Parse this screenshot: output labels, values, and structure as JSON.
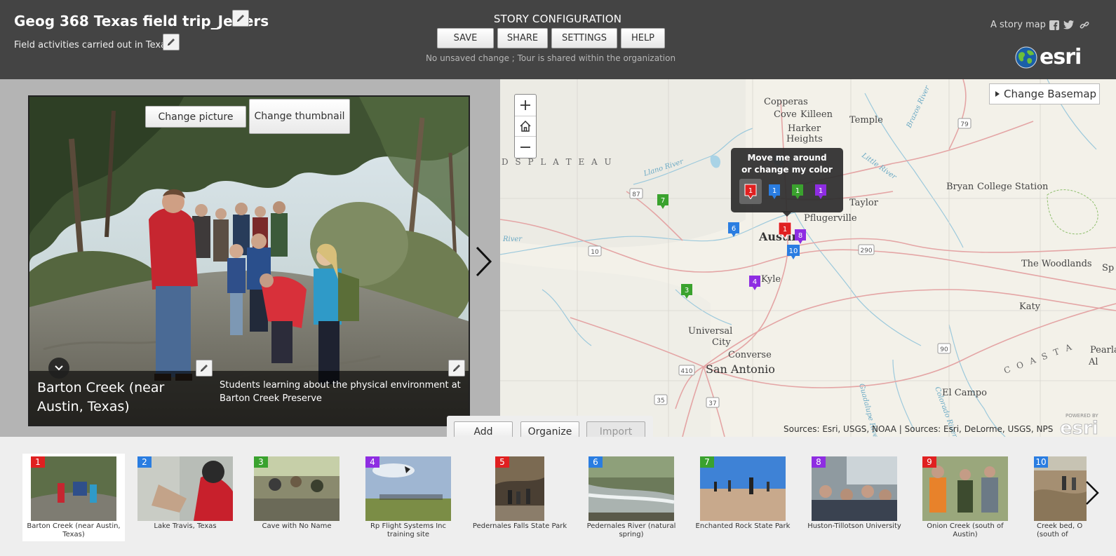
{
  "header": {
    "title": "Geog 368 Texas field trip_Jeffers",
    "subtitle": "Field activities carried out in Texas",
    "config_title": "STORY CONFIGURATION",
    "buttons": {
      "save": "SAVE",
      "share": "SHARE",
      "settings": "SETTINGS",
      "help": "HELP"
    },
    "status": "No unsaved change ; Tour is shared within the organization",
    "storymap_link": "A story map",
    "logo_text": "esri",
    "icons": [
      "facebook-icon",
      "twitter-icon",
      "link-icon",
      "pencil-icon"
    ]
  },
  "media": {
    "change_picture": "Change picture",
    "change_thumbnail": "Change thumbnail",
    "place_name": "Barton Creek (near Austin, Texas)",
    "description": "Students learning about the physical environment at Barton Creek Preserve"
  },
  "map": {
    "change_basemap": "Change Basemap",
    "popup_text_1": "Move me around",
    "popup_text_2": "or change my color",
    "popup_colors": [
      {
        "label": "1",
        "color": "#e02020"
      },
      {
        "label": "1",
        "color": "#2a7de1"
      },
      {
        "label": "1",
        "color": "#3aa22e"
      },
      {
        "label": "1",
        "color": "#8e2de2"
      }
    ],
    "sources": "Sources: Esri, USGS, NOAA | Sources: Esri, DeLorme, USGS, NPS",
    "powered_by": "POWERED BY",
    "cities": [
      "Copperas",
      "Cove",
      "Killeen",
      "Temple",
      "Harker",
      "Heights",
      "Taylor",
      "Pflugerville",
      "Austin",
      "Bryan",
      "College Station",
      "Kyle",
      "The Woodlands",
      "Katy",
      "Universal",
      "City",
      "Converse",
      "San Antonio",
      "El Campo",
      "Pearlan",
      "Al",
      "Sp"
    ],
    "region_labels": [
      "D S   P L A T E A U",
      "C O A S T A"
    ],
    "rivers": [
      "Llano River",
      "Brazos River",
      "Little River",
      "Guadalupe River",
      "Colorado River",
      "River"
    ],
    "highways": [
      "79",
      "87",
      "10",
      "290",
      "90",
      "410",
      "35",
      "37"
    ],
    "markers": [
      {
        "label": "7",
        "color": "#3aa22e"
      },
      {
        "label": "6",
        "color": "#2a7de1"
      },
      {
        "label": "1",
        "color": "#e02020"
      },
      {
        "label": "8",
        "color": "#8e2de2"
      },
      {
        "label": "10",
        "color": "#2a7de1"
      },
      {
        "label": "4",
        "color": "#8e2de2"
      },
      {
        "label": "3",
        "color": "#3aa22e"
      }
    ]
  },
  "builder": {
    "add": "Add",
    "organize": "Organize",
    "import": "Import"
  },
  "carousel": [
    {
      "num": "1",
      "color": "#e02020",
      "label": "Barton Creek (near Austin, Texas)"
    },
    {
      "num": "2",
      "color": "#2a7de1",
      "label": "Lake Travis, Texas"
    },
    {
      "num": "3",
      "color": "#3aa22e",
      "label": "Cave with No Name"
    },
    {
      "num": "4",
      "color": "#8e2de2",
      "label": "Rp Flight Systems Inc training site"
    },
    {
      "num": "5",
      "color": "#e02020",
      "label": "Pedernales Falls State Park"
    },
    {
      "num": "6",
      "color": "#2a7de1",
      "label": "Pedernales River (natural spring)"
    },
    {
      "num": "7",
      "color": "#3aa22e",
      "label": "Enchanted Rock State Park"
    },
    {
      "num": "8",
      "color": "#8e2de2",
      "label": "Huston-Tillotson University"
    },
    {
      "num": "9",
      "color": "#e02020",
      "label": "Onion Creek (south of Austin)"
    },
    {
      "num": "10",
      "color": "#2a7de1",
      "label": "Creek bed, O (south of"
    }
  ]
}
